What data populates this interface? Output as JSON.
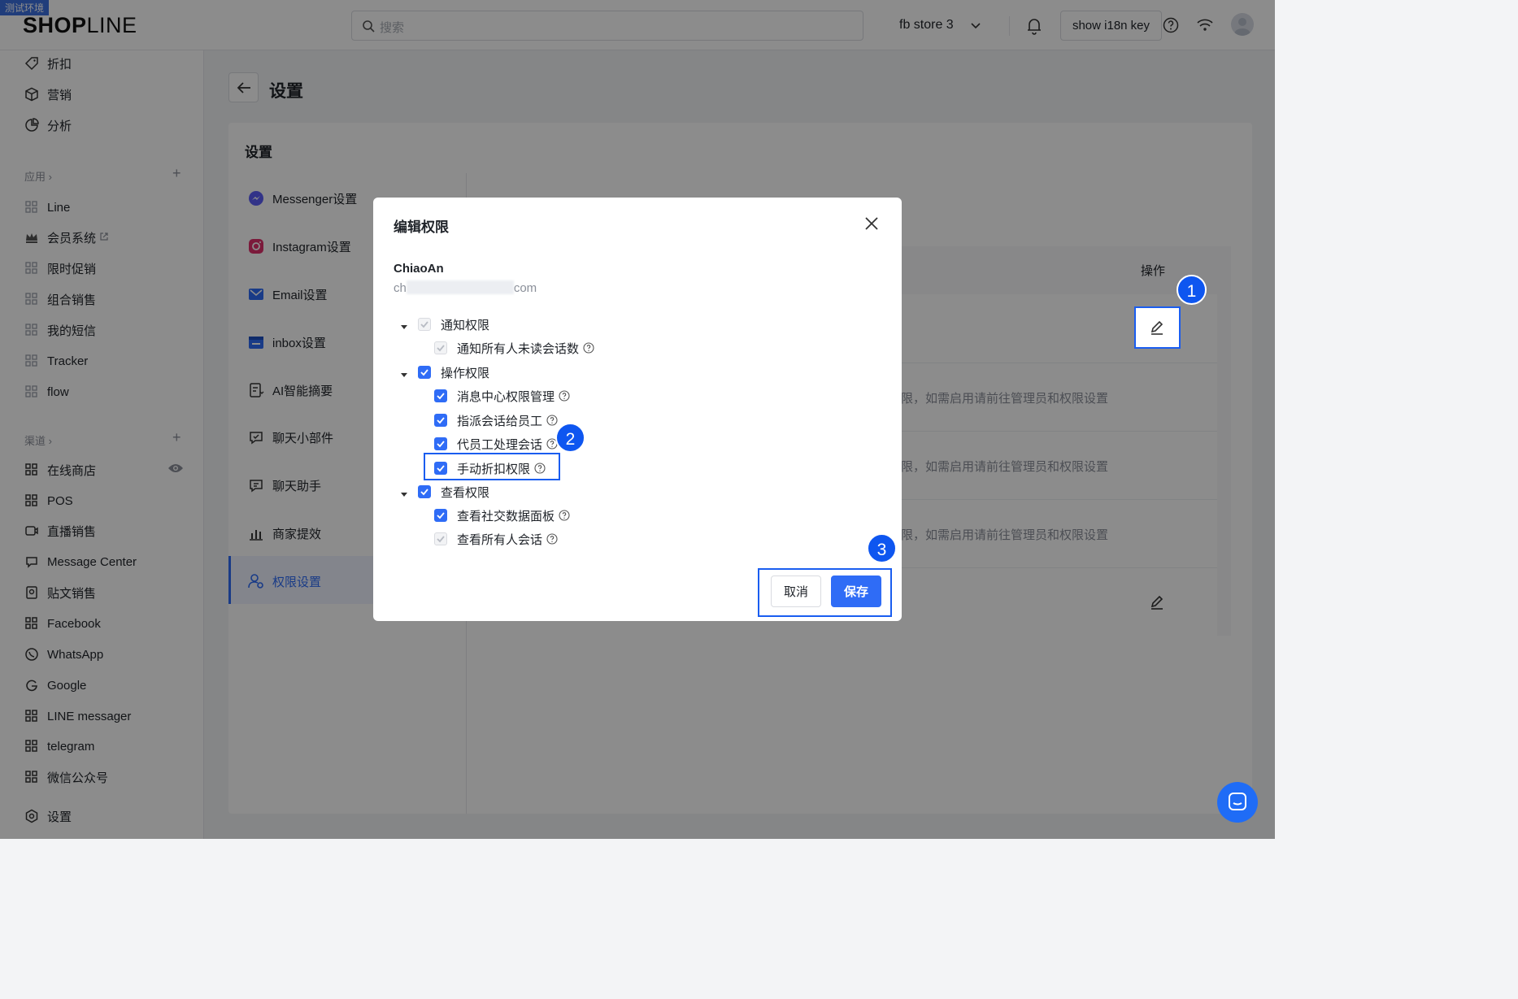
{
  "env_badge": "测试环境",
  "logo": {
    "bold": "SHOP",
    "thin": "LINE"
  },
  "search": {
    "placeholder": "搜索"
  },
  "header": {
    "store_name": "fb store 3",
    "i18n_button": "show i18n key"
  },
  "sidebar": {
    "top_items": [
      {
        "label": "折扣",
        "icon": "tag-icon"
      },
      {
        "label": "营销",
        "icon": "cube-icon"
      },
      {
        "label": "分析",
        "icon": "pie-chart-icon"
      }
    ],
    "apps_section": "应用",
    "app_items": [
      {
        "label": "Line",
        "icon": "app-grid-icon"
      },
      {
        "label": "会员系统",
        "icon": "crown-icon",
        "external": true
      },
      {
        "label": "限时促销",
        "icon": "app-grid-icon"
      },
      {
        "label": "组合销售",
        "icon": "app-grid-icon"
      },
      {
        "label": "我的短信",
        "icon": "app-grid-icon"
      },
      {
        "label": "Tracker",
        "icon": "app-grid-icon"
      },
      {
        "label": "flow",
        "icon": "app-grid-icon"
      }
    ],
    "channels_section": "渠道",
    "channel_items": [
      {
        "label": "在线商店",
        "icon": "store-grid-icon"
      },
      {
        "label": "POS",
        "icon": "store-grid-icon"
      },
      {
        "label": "直播销售",
        "icon": "live-icon"
      },
      {
        "label": "Message Center",
        "icon": "message-icon"
      },
      {
        "label": "贴文销售",
        "icon": "post-icon"
      },
      {
        "label": "Facebook",
        "icon": "store-grid-icon"
      },
      {
        "label": "WhatsApp",
        "icon": "whatsapp-icon"
      },
      {
        "label": "Google",
        "icon": "google-icon"
      },
      {
        "label": "LINE messager",
        "icon": "store-grid-icon"
      },
      {
        "label": "telegram",
        "icon": "store-grid-icon"
      },
      {
        "label": "微信公众号",
        "icon": "store-grid-icon"
      }
    ],
    "settings": "设置"
  },
  "page": {
    "title": "设置",
    "panel_title": "设置"
  },
  "sub_nav": [
    {
      "label": "Messenger设置",
      "icon": "messenger-icon"
    },
    {
      "label": "Instagram设置",
      "icon": "instagram-icon"
    },
    {
      "label": "Email设置",
      "icon": "email-icon"
    },
    {
      "label": "inbox设置",
      "icon": "inbox-icon"
    },
    {
      "label": "AI智能摘要",
      "icon": "ai-summary-icon"
    },
    {
      "label": "聊天小部件",
      "icon": "chat-widget-icon"
    },
    {
      "label": "聊天助手",
      "icon": "chat-assistant-icon"
    },
    {
      "label": "商家提效",
      "icon": "chart-icon"
    },
    {
      "label": "权限设置",
      "icon": "user-permission-icon",
      "active": true
    }
  ],
  "table": {
    "op_header": "操作",
    "row_note_partial": "限，如需启用请前往管理员和权限设置"
  },
  "modal": {
    "title": "编辑权限",
    "user_name": "ChiaoAn",
    "email_prefix": "ch",
    "email_suffix": "com",
    "tree": [
      {
        "label": "通知权限",
        "level": 0,
        "state": "disabled",
        "children": [
          {
            "label": "通知所有人未读会话数",
            "state": "disabled",
            "help": true
          }
        ]
      },
      {
        "label": "操作权限",
        "level": 0,
        "state": "checked",
        "children": [
          {
            "label": "消息中心权限管理",
            "state": "checked",
            "help": true
          },
          {
            "label": "指派会话给员工",
            "state": "checked",
            "help": true
          },
          {
            "label": "代员工处理会话",
            "state": "checked",
            "help": true
          },
          {
            "label": "手动折扣权限",
            "state": "checked",
            "help": true
          }
        ]
      },
      {
        "label": "查看权限",
        "level": 0,
        "state": "checked",
        "children": [
          {
            "label": "查看社交数据面板",
            "state": "checked",
            "help": true
          },
          {
            "label": "查看所有人会话",
            "state": "disabled",
            "help": true
          }
        ]
      }
    ],
    "cancel": "取消",
    "save": "保存"
  },
  "markers": [
    "1",
    "2",
    "3"
  ],
  "colors": {
    "primary": "#2f6cf6",
    "highlight": "#1a5df0",
    "overlay": "rgba(0,0,0,0.45)"
  }
}
